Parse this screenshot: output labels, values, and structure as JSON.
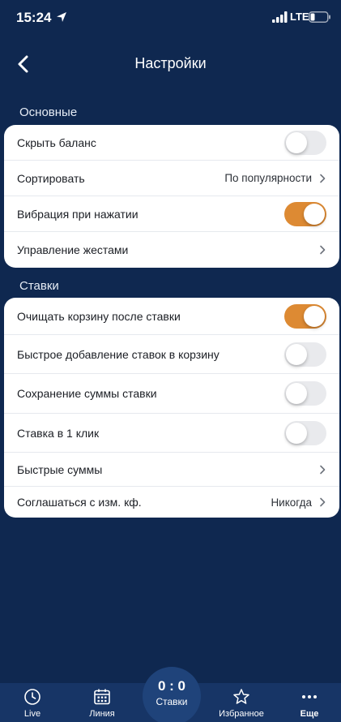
{
  "status_bar": {
    "time": "15:24",
    "network": "LTE"
  },
  "header": {
    "title": "Настройки"
  },
  "sections": [
    {
      "title": "Основные",
      "rows": [
        {
          "label": "Скрыть баланс",
          "type": "toggle",
          "on": false
        },
        {
          "label": "Сортировать",
          "type": "link",
          "value": "По популярности"
        },
        {
          "label": "Вибрация при нажатии",
          "type": "toggle",
          "on": true
        },
        {
          "label": "Управление жестами",
          "type": "link",
          "value": ""
        }
      ]
    },
    {
      "title": "Ставки",
      "rows": [
        {
          "label": "Очищать корзину после ставки",
          "type": "toggle",
          "on": true
        },
        {
          "label": "Быстрое добавление ставок в корзину",
          "type": "toggle",
          "on": false
        },
        {
          "label": "Сохранение суммы ставки",
          "type": "toggle",
          "on": false
        },
        {
          "label": "Ставка в 1 клик",
          "type": "toggle",
          "on": false
        },
        {
          "label": "Быстрые суммы",
          "type": "link",
          "value": ""
        },
        {
          "label": "Соглашаться с изм. кф.",
          "type": "link",
          "value": "Никогда"
        }
      ]
    }
  ],
  "tabbar": {
    "live": "Live",
    "line": "Линия",
    "bets_score": "0 : 0",
    "bets": "Ставки",
    "favorites": "Избранное",
    "more": "Еще"
  },
  "colors": {
    "background": "#0f2850",
    "tabbar": "#173566",
    "toggle_on": "#dd8a33",
    "toggle_off": "#e9eaed"
  }
}
